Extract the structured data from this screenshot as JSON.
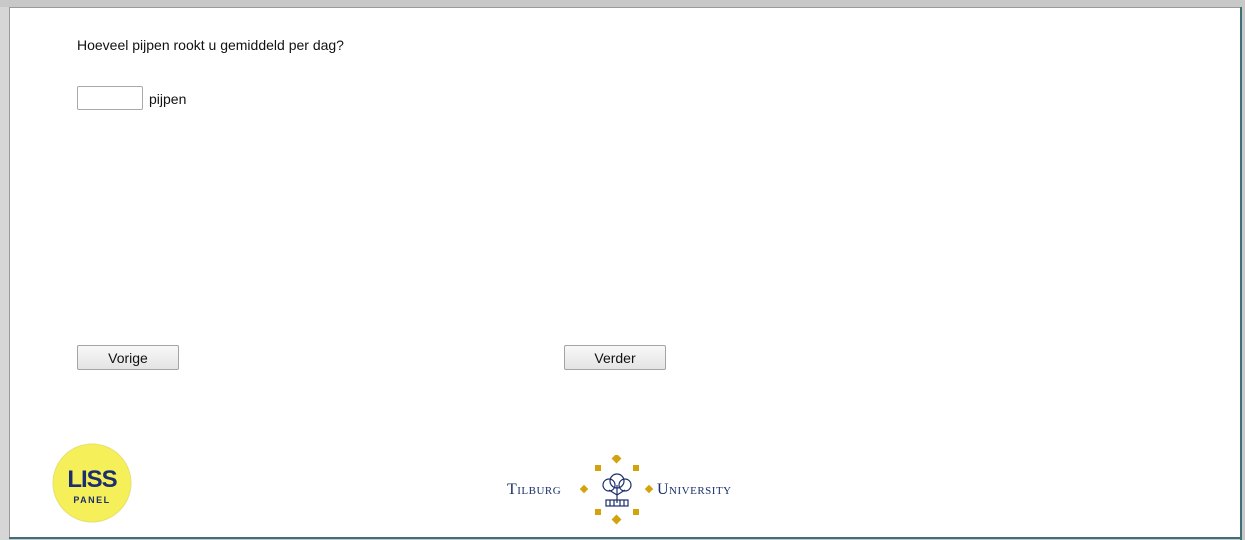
{
  "question": {
    "text": "Hoeveel pijpen rookt u gemiddeld per dag?"
  },
  "answer": {
    "value": "",
    "unit_label": "pijpen"
  },
  "navigation": {
    "prev_label": "Vorige",
    "next_label": "Verder"
  },
  "logos": {
    "liss": {
      "top_text": "LISS",
      "bottom_text": "PANEL",
      "fill_color": "#f5ef5a",
      "text_color": "#1a2f6b"
    },
    "tilburg": {
      "left_word": "Tilburg",
      "right_word": "University",
      "emblem_color": "#d4a20a",
      "text_color": "#1a2f6b"
    }
  }
}
